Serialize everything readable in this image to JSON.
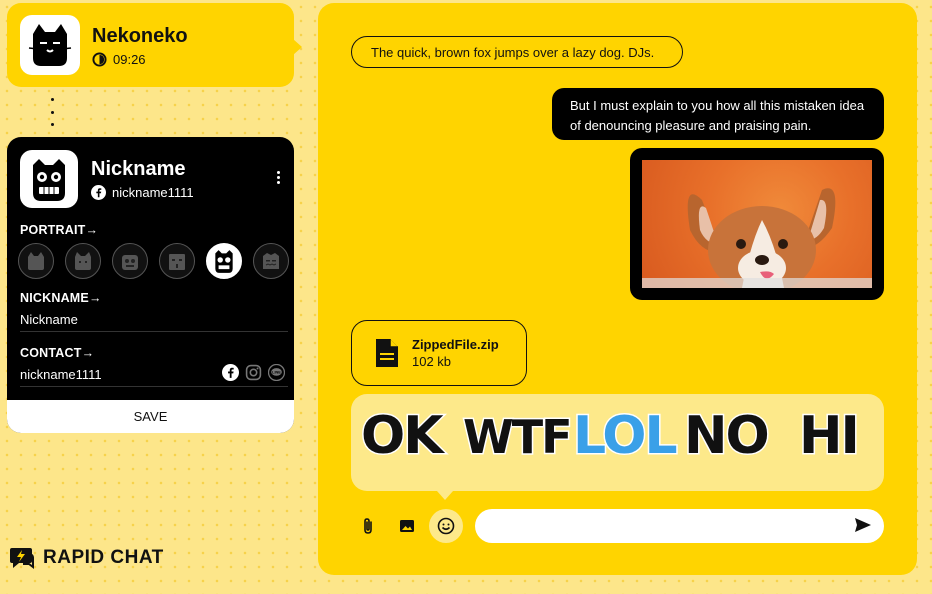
{
  "contact": {
    "name": "Nekoneko",
    "time": "09:26",
    "avatar_icon": "cat-icon"
  },
  "profile": {
    "title": "Nickname",
    "handle": "nickname1111",
    "portrait_label": "PORTRAIT→",
    "portraits": [
      "cat-portrait-1",
      "cat-portrait-2",
      "robot-portrait",
      "monster-portrait",
      "owl-portrait",
      "zombie-portrait"
    ],
    "nickname_label": "NICKNAME→",
    "nickname_value": "Nickname",
    "contact_label": "CONTACT→",
    "contact_value": "nickname1111",
    "save_label": "SAVE"
  },
  "brand": {
    "name": "RAPID CHAT"
  },
  "chat": {
    "incoming_text": "The quick, brown fox jumps over a lazy dog. DJs.",
    "outgoing_text": "But I must explain to you how all this mistaken idea of denouncing pleasure and praising pain.",
    "file_name": "ZippedFile.zip",
    "file_size": "102 kb",
    "stickers": [
      "OK",
      "WTF",
      "LOL",
      "NO",
      "HI"
    ]
  },
  "composer": {
    "placeholder": ""
  },
  "colors": {
    "accent": "#ffd400",
    "background": "#fde68a",
    "dark": "#000000"
  }
}
